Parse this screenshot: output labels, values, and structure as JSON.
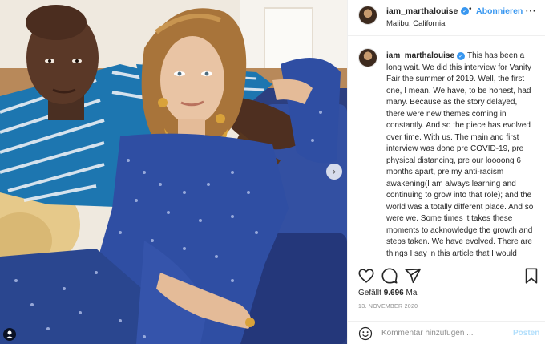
{
  "post": {
    "username": "iam_marthalouise",
    "follow_label": "Abonnieren",
    "location": "Malibu, California",
    "caption": "This has been a long wait. We did this interview for Vanity Fair the summer of 2019. Well, the first one, I mean. We have, to be honest, had many. Because as the story delayed, there were new themes coming in constantly. And so the piece has evolved over time. With us. The main and first interview was done pre COVID-19, pre physical distancing, pre our loooong 6 months apart, pre my anti-racism awakening(I am always learning and continuing to grow into that role); and the world was a totally different place. And so were we. Some times it takes these moments to acknowledge the growth and steps taken. We have evolved. There are things I say in this article that I would never say today. Things that make me",
    "likes_prefix": "Gefällt ",
    "likes_count": "9.696",
    "likes_suffix": " Mal",
    "date": "13. NOVEMBER 2020",
    "separator": "•"
  },
  "comment": {
    "placeholder": "Kommentar hinzufügen ...",
    "post_label": "Posten"
  },
  "icons": {
    "more": "more-options-icon",
    "like": "heart-icon",
    "comment": "comment-bubble-icon",
    "share": "paper-plane-icon",
    "save": "bookmark-icon",
    "emoji": "emoji-smiley-icon",
    "next": "chevron-right-icon",
    "tag": "user-tag-icon",
    "verified": "verified-badge-icon"
  },
  "colors": {
    "accent": "#3897f0",
    "post_disabled": "#b2dffc",
    "muted": "#8e8e8e",
    "dress_blue": "#2f4ea3",
    "gold": "#d9a23a"
  }
}
